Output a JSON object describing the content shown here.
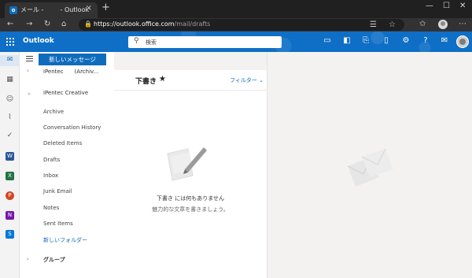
{
  "browser": {
    "tab_title": "メール - 　　 - Outlook",
    "url_host": "https://outlook.office.com",
    "url_path": "/mail/drafts"
  },
  "outlook": {
    "brand": "Outlook",
    "search_placeholder": "検索",
    "new_message_label": "新しいメッセージ",
    "accounts": [
      {
        "label": "iPentec　　(Archiv...",
        "expanded": false
      },
      {
        "label": "iPentec Creative",
        "expanded": true
      }
    ],
    "folders": [
      "Archive",
      "Conversation History",
      "Deleted Items",
      "Drafts",
      "Inbox",
      "Junk Email",
      "Notes",
      "Sent Items"
    ],
    "new_folder_label": "新しいフォルダー",
    "groups_label": "グループ",
    "list_title": "下書き",
    "filter_label": "フィルター",
    "empty_title": "下書き には何もありません",
    "empty_subtitle": "魅力的な文章を書きましょう。"
  },
  "colors": {
    "brand_blue": "#0f6cbd",
    "topbar_blue": "#0f6fc6"
  },
  "icons": {
    "waffle": "app-launcher-icon",
    "search": "search-icon",
    "settings": "gear-icon",
    "help": "help-icon"
  }
}
